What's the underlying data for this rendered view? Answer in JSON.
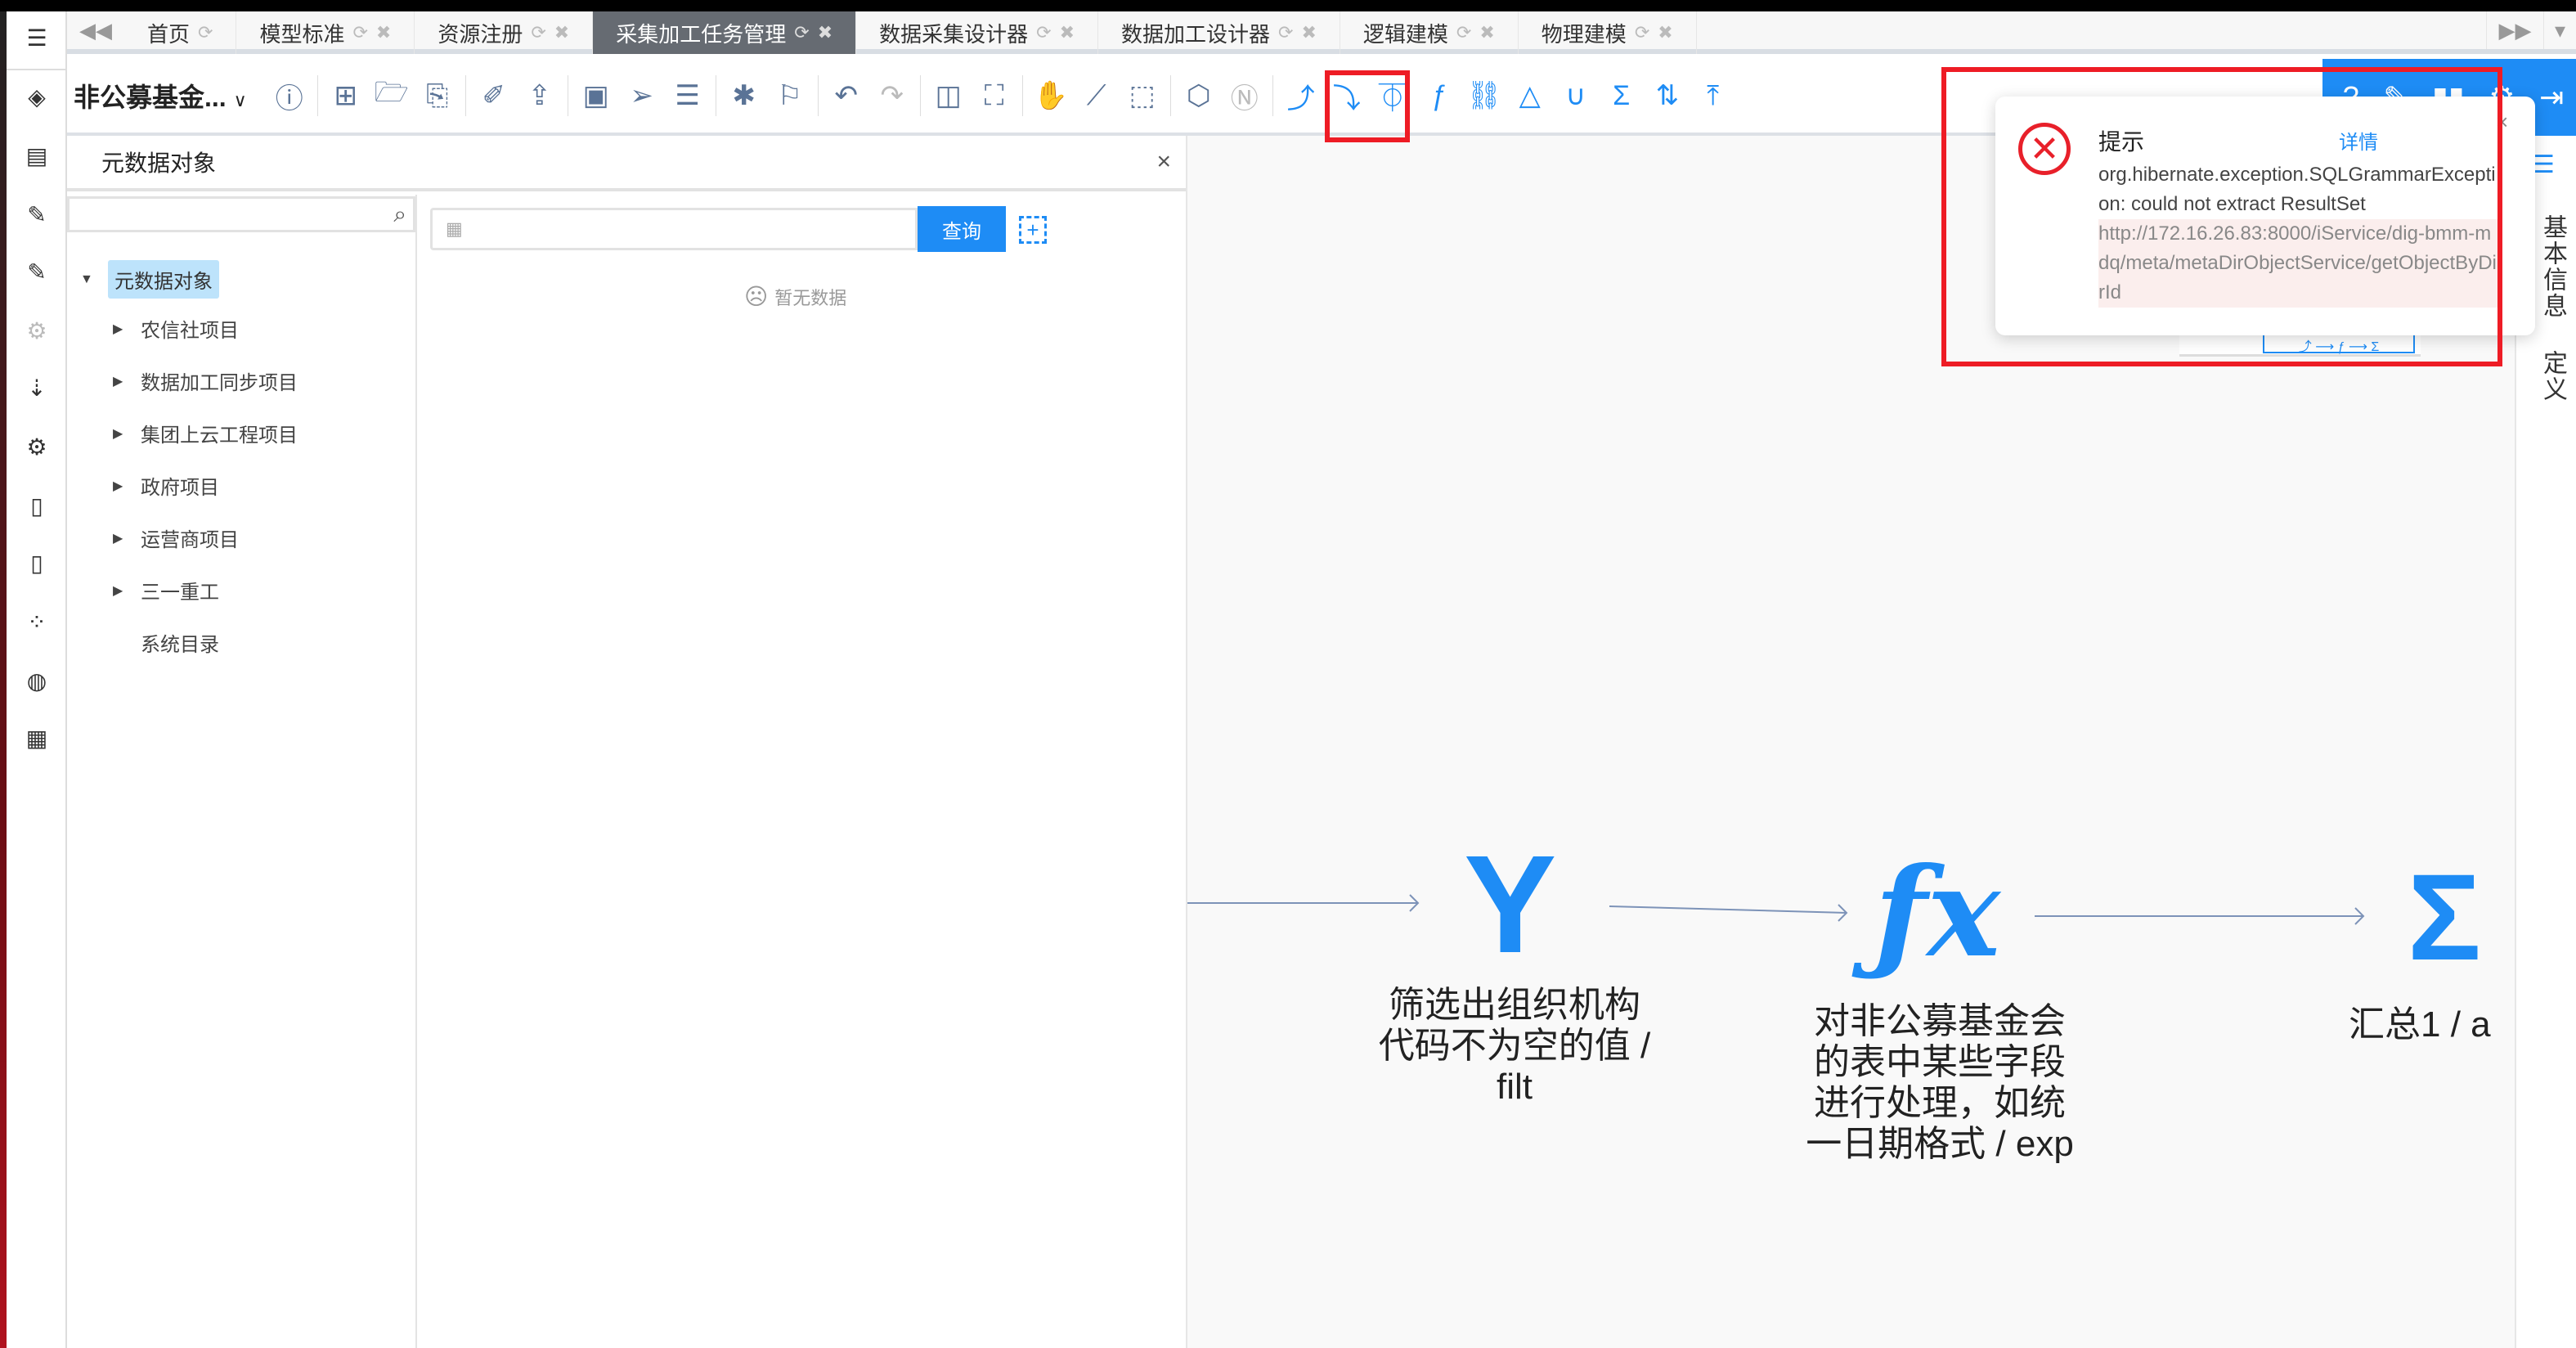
{
  "tabs": {
    "items": [
      {
        "label": "首页",
        "closable": false
      },
      {
        "label": "模型标准",
        "closable": true
      },
      {
        "label": "资源注册",
        "closable": true
      },
      {
        "label": "采集加工任务管理",
        "closable": true,
        "active": true
      },
      {
        "label": "数据采集设计器",
        "closable": true
      },
      {
        "label": "数据加工设计器",
        "closable": true
      },
      {
        "label": "逻辑建模",
        "closable": true
      },
      {
        "label": "物理建模",
        "closable": true
      }
    ]
  },
  "toolbar": {
    "project": "非公募基金...",
    "project_caret": "∨"
  },
  "panel": {
    "title": "元数据对象",
    "close": "×",
    "query_btn": "查询",
    "empty": "暂无数据",
    "tree": {
      "root": "元数据对象",
      "children": [
        "农信社项目",
        "数据加工同步项目",
        "集团上云工程项目",
        "政府项目",
        "运营商项目",
        "三一重工",
        "系统目录"
      ]
    }
  },
  "flow": {
    "nodes": [
      {
        "label": "筛选出组织机构代码不为空的值 / filt",
        "icon": "filter-icon"
      },
      {
        "label": "对非公募基金会的表中某些字段进行处理，如统一日期格式 / exp",
        "icon": "function-icon"
      },
      {
        "label": "汇总1 / a",
        "icon": "sigma-icon"
      }
    ]
  },
  "right_panel": {
    "tab1": "基本信息",
    "tab2": "定义"
  },
  "notice": {
    "title": "提示",
    "detail": "详情",
    "message": "org.hibernate.exception.SQLGrammarException: could not extract ResultSet",
    "url": "http://172.16.26.83:8000/iService/dig-bmm-mdq/meta/metaDirObjectService/getObjectByDirId",
    "close": "×"
  },
  "colors": {
    "accent": "#1e8cf5",
    "error": "#e8202a",
    "annotation": "#ee1c25"
  }
}
